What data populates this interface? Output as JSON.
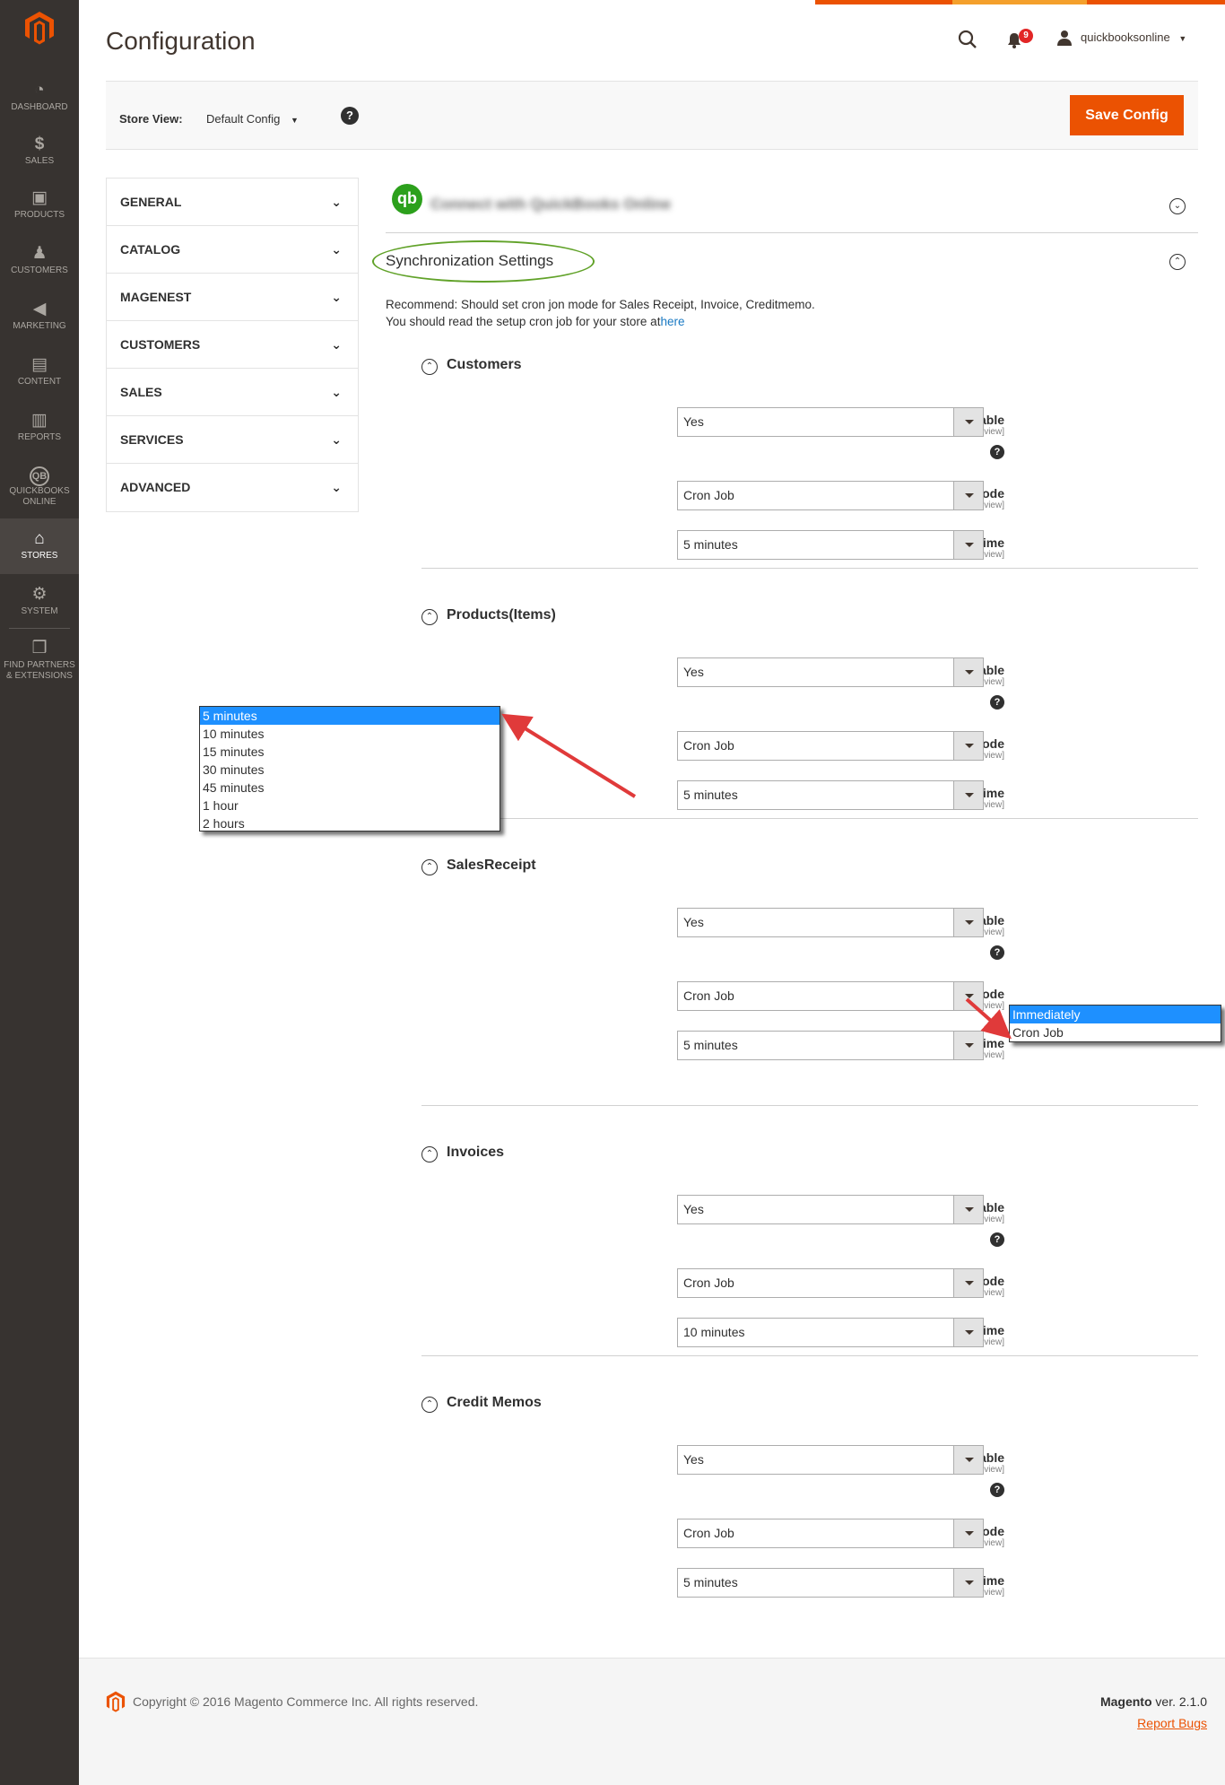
{
  "nav": [
    {
      "label": "Dashboard",
      "icon": "dashboard-icon"
    },
    {
      "label": "Sales",
      "icon": "dollar-icon"
    },
    {
      "label": "Products",
      "icon": "box-icon"
    },
    {
      "label": "Customers",
      "icon": "person-icon"
    },
    {
      "label": "Marketing",
      "icon": "megaphone-icon"
    },
    {
      "label": "Content",
      "icon": "layout-icon"
    },
    {
      "label": "Reports",
      "icon": "bar-chart-icon"
    },
    {
      "label": "QuickBooks Online",
      "icon": "quickbooks-icon"
    },
    {
      "label": "Stores",
      "icon": "store-icon"
    },
    {
      "label": "System",
      "icon": "gear-icon"
    },
    {
      "label": "Find Partners & Extensions",
      "icon": "cubes-icon"
    }
  ],
  "header": {
    "title": "Configuration",
    "notification_count": "9",
    "user": "quickbooksonline"
  },
  "store_bar": {
    "label": "Store View:",
    "value": "Default Config",
    "save_label": "Save Config"
  },
  "tabs": [
    "GENERAL",
    "CATALOG",
    "MAGENEST",
    "CUSTOMERS",
    "SALES",
    "SERVICES",
    "ADVANCED"
  ],
  "qb_section": {
    "logo": "qb",
    "title": "Connect with QuickBooks Online"
  },
  "sync": {
    "title": "Synchronization Settings",
    "note_line1": "Recommend: Should set cron jon mode for Sales Receipt, Invoice, Creditmemo.",
    "note_line2": "You should read the setup cron job for your store at",
    "note_link": "here"
  },
  "labels": {
    "enable": "Enable",
    "sync_mode": "Sync Mode",
    "time": "Time",
    "scope": "[store view]"
  },
  "groups": [
    {
      "title": "Customers",
      "enable": "Yes",
      "sync_mode": "Cron Job",
      "time": "5 minutes"
    },
    {
      "title": "Products(Items)",
      "enable": "Yes",
      "sync_mode": "Cron Job",
      "time": "5 minutes"
    },
    {
      "title": "SalesReceipt",
      "enable": "Yes",
      "sync_mode": "Cron Job",
      "time": "5 minutes"
    },
    {
      "title": "Invoices",
      "enable": "Yes",
      "sync_mode": "Cron Job",
      "time": "10 minutes"
    },
    {
      "title": "Credit Memos",
      "enable": "Yes",
      "sync_mode": "Cron Job",
      "time": "5 minutes"
    }
  ],
  "time_options": [
    "5 minutes",
    "10 minutes",
    "15 minutes",
    "30 minutes",
    "45 minutes",
    "1 hour",
    "2 hours"
  ],
  "sync_mode_options": [
    "Immediately",
    "Cron Job"
  ],
  "footer": {
    "copyright": "Copyright © 2016 Magento Commerce Inc. All rights reserved.",
    "brand": "Magento",
    "version": " ver. 2.1.0",
    "report": "Report Bugs"
  },
  "colors": {
    "accent": "#eb5202",
    "sidebar": "#373330",
    "highlight": "#1e90ff",
    "annotation": "#e03a3a",
    "oval": "#61a229"
  }
}
